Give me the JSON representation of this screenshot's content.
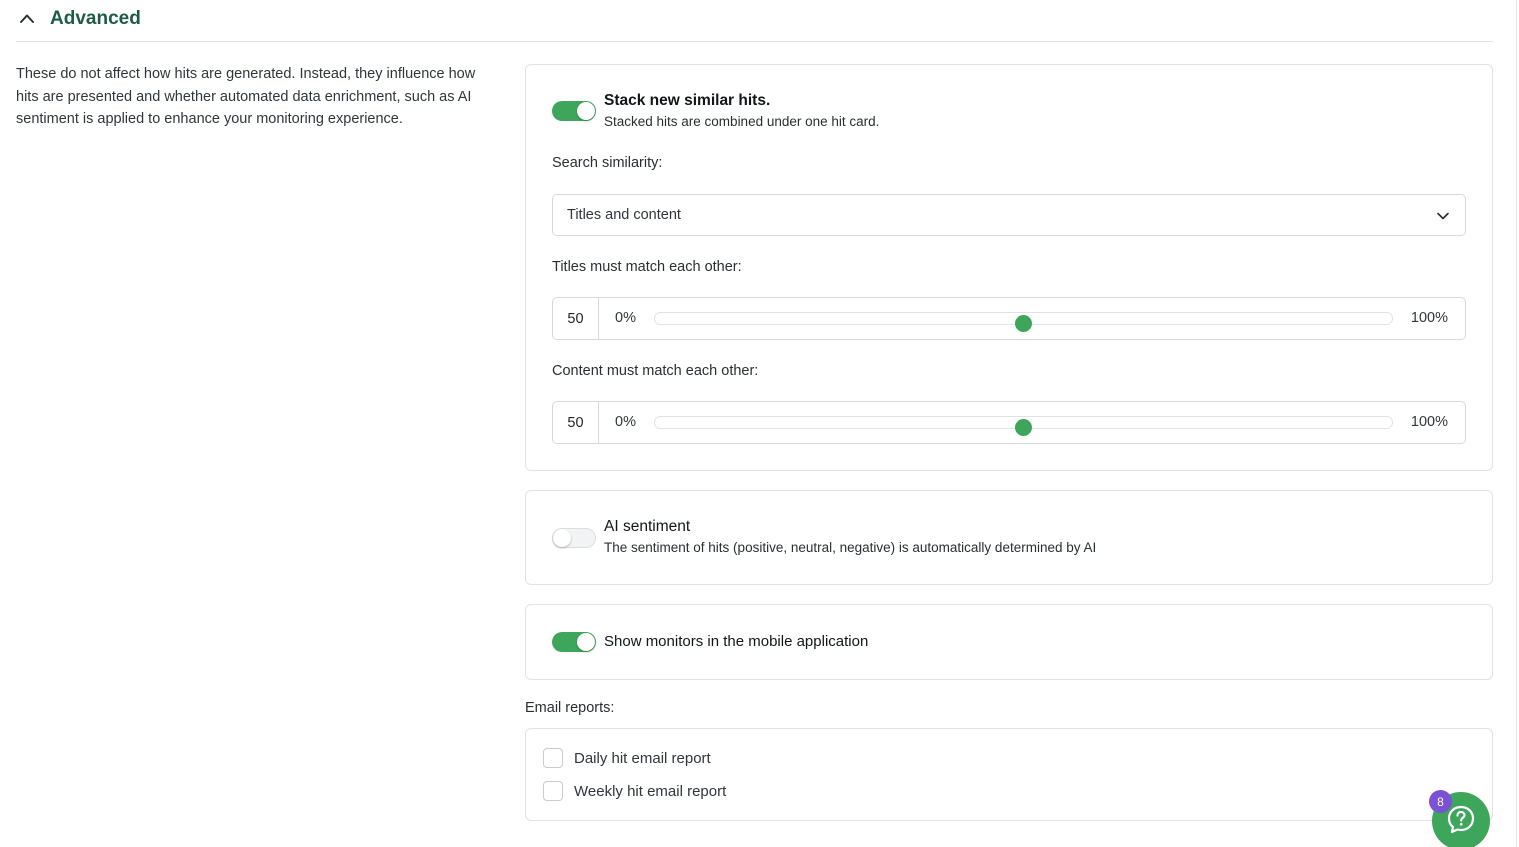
{
  "section": {
    "title": "Advanced",
    "description": "These do not affect how hits are generated. Instead, they influence how hits are presented and whether automated data enrichment, such as AI sentiment is applied to enhance your monitoring experience."
  },
  "stacking": {
    "toggle_on": true,
    "title": "Stack new similar hits.",
    "subtitle": "Stacked hits are combined under one hit card.",
    "search_similarity_label": "Search similarity:",
    "search_similarity_value": "Titles and content",
    "titles_label": "Titles must match each other:",
    "titles_value": "50",
    "content_label": "Content must match each other:",
    "content_value": "50",
    "slider_min": "0%",
    "slider_max": "100%"
  },
  "ai_sentiment": {
    "toggle_on": false,
    "title": "AI sentiment",
    "subtitle": "The sentiment of hits (positive, neutral, negative) is automatically determined by AI"
  },
  "mobile": {
    "toggle_on": true,
    "title": "Show monitors in the mobile application"
  },
  "email_reports": {
    "label": "Email reports:",
    "options": [
      {
        "label": "Daily hit email report",
        "checked": false
      },
      {
        "label": "Weekly hit email report",
        "checked": false
      }
    ]
  },
  "help": {
    "badge_count": "8"
  },
  "colors": {
    "accent_green": "#3ea65a",
    "title_green": "#1f5c45",
    "badge_purple": "#7b52d6"
  },
  "icons": {
    "collapse": "chevron-up-icon",
    "dropdown": "chevron-down-icon",
    "help": "help-chat-icon"
  }
}
